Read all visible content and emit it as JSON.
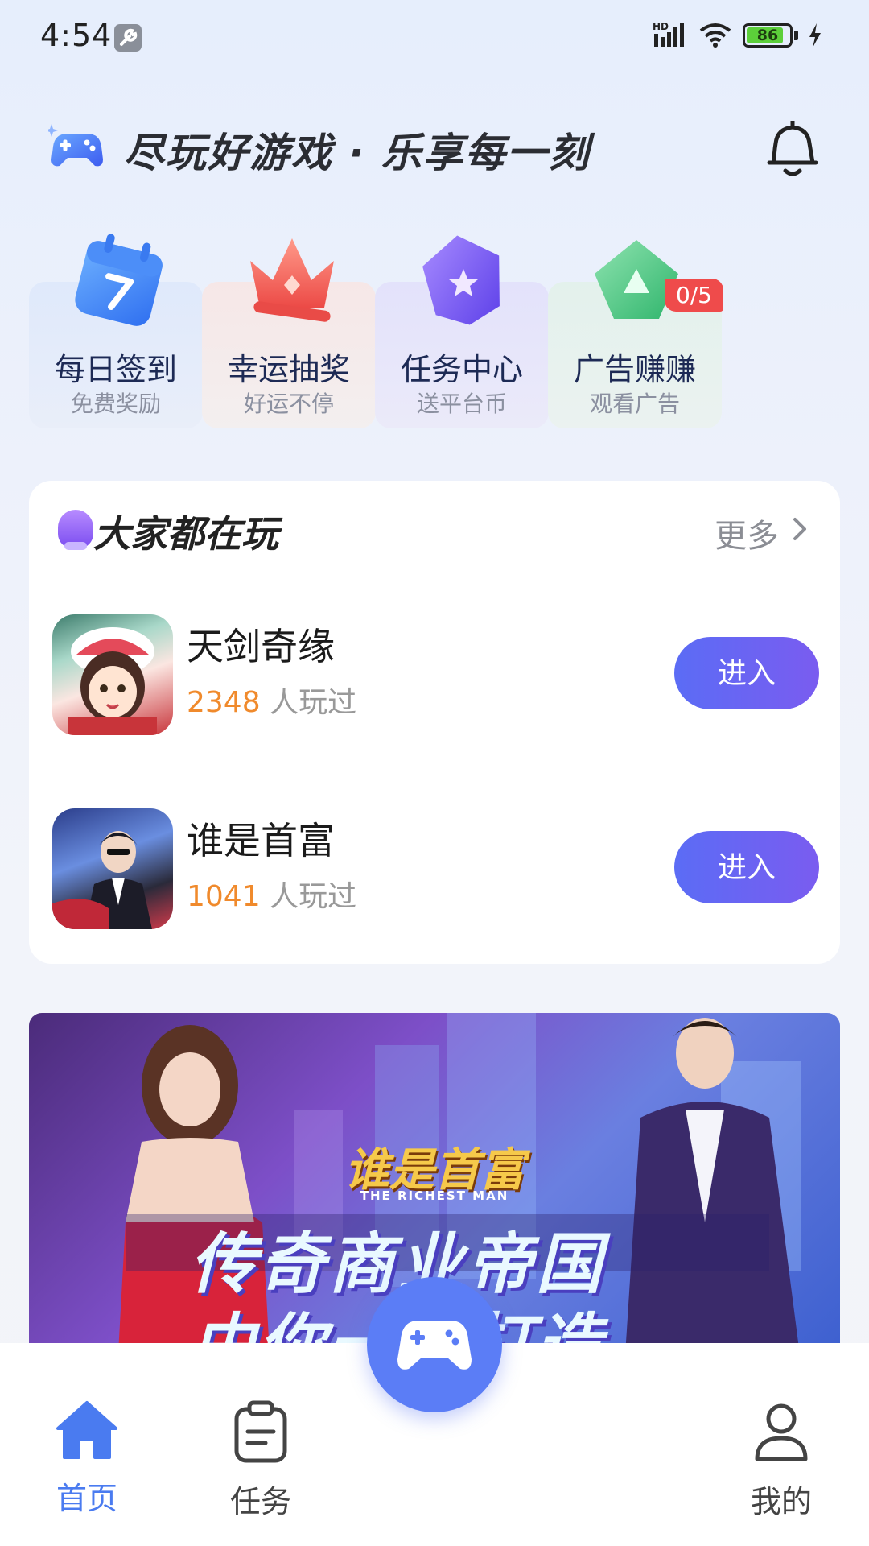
{
  "status_bar": {
    "time": "4:54",
    "battery": "86",
    "network_label": "HD",
    "icons": [
      "wrench-icon",
      "signal-icon",
      "wifi-icon",
      "battery-icon",
      "charging-icon"
    ]
  },
  "header": {
    "slogan": "尽玩好游戏 · 乐享每一刻",
    "icons": [
      "gamepad-logo-icon",
      "bell-icon"
    ]
  },
  "quick_actions": [
    {
      "title": "每日签到",
      "subtitle": "免费奖励",
      "icon": "calendar-icon",
      "bg": "#e3ecfb"
    },
    {
      "title": "幸运抽奖",
      "subtitle": "好运不停",
      "icon": "crown-icon",
      "bg": "#f6ecec"
    },
    {
      "title": "任务中心",
      "subtitle": "送平台币",
      "icon": "star-folder-icon",
      "bg": "#e6e5fb"
    },
    {
      "title": "广告赚赚",
      "subtitle": "观看广告",
      "icon": "play-gift-icon",
      "bg": "#e7f2ef",
      "badge": "0/5"
    }
  ],
  "playing": {
    "title": "大家都在玩",
    "more": "更多",
    "games": [
      {
        "name": "天剑奇缘",
        "count": "2348",
        "count_suffix": "人玩过",
        "button": "进入"
      },
      {
        "name": "谁是首富",
        "count": "1041",
        "count_suffix": "人玩过",
        "button": "进入"
      }
    ]
  },
  "banner": {
    "title": "谁是首富",
    "subtitle": "THE RICHEST MAN",
    "slogan_line1": "传奇商业帝国",
    "slogan_line2": "由你一手打造"
  },
  "bottom_nav": [
    {
      "label": "首页",
      "icon": "home-icon",
      "active": true
    },
    {
      "label": "任务",
      "icon": "clipboard-icon",
      "active": false
    },
    {
      "label": "我的",
      "icon": "user-icon",
      "active": false
    }
  ],
  "colors": {
    "accent": "#5b7df6",
    "count_orange": "#f08a2c",
    "badge_red": "#ef4b4b",
    "active_nav": "#4a7bf0"
  }
}
